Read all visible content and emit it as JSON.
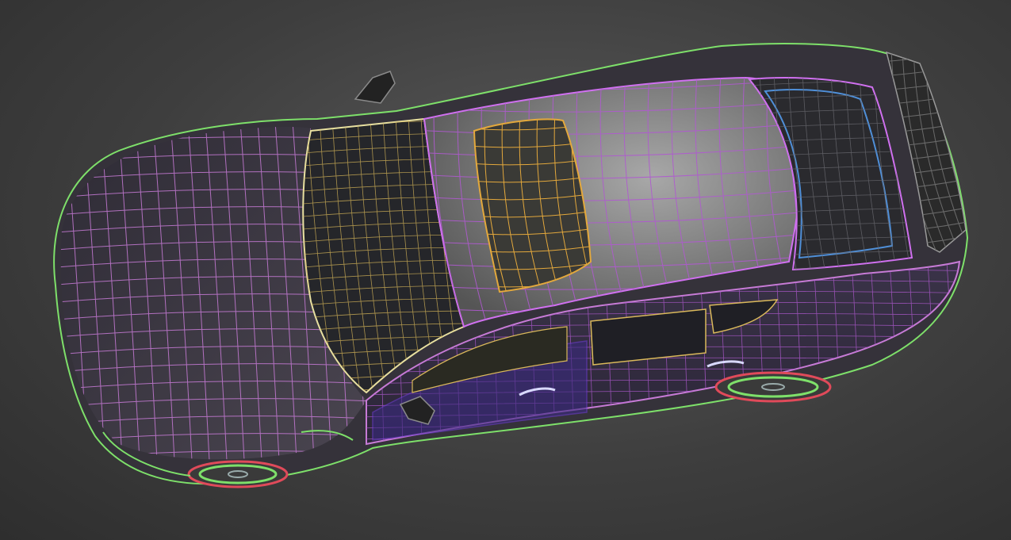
{
  "viewport": {
    "background": "#3f3f3f",
    "subject": "wireframe-car-model",
    "colors": {
      "hood_wire": "#c77bd6",
      "body_edge_wire": "#7ee06a",
      "roof_wire": "#b05ad0",
      "glass_wire": "#d9b85a",
      "sunroof_wire": "#e3a83c",
      "side_panel_wire": "#6a3ad0",
      "rear_glass_wire": "#4f8fd8",
      "spoiler_wire": "#9a9a9a",
      "rim_wire": "#e04a5a"
    }
  }
}
